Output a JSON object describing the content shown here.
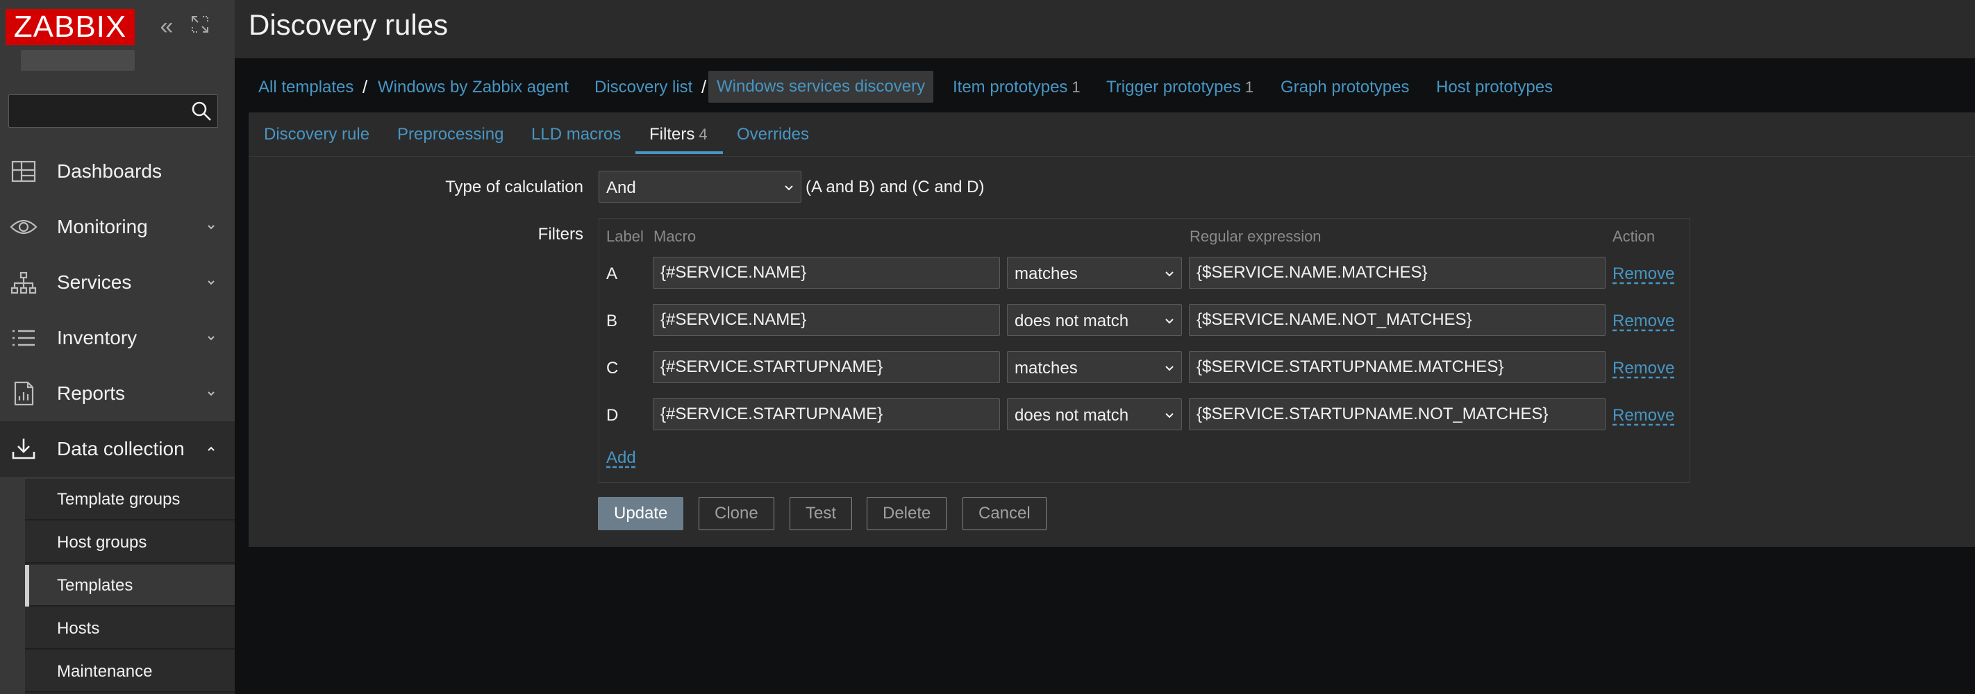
{
  "app": {
    "logo": "ZABBIX",
    "page_title": "Discovery rules"
  },
  "sidebar": {
    "search_placeholder": "",
    "search_value": "",
    "nav": [
      {
        "label": "Dashboards",
        "icon": "dashboards-icon",
        "expandable": false
      },
      {
        "label": "Monitoring",
        "icon": "eye-icon",
        "expandable": true
      },
      {
        "label": "Services",
        "icon": "services-icon",
        "expandable": true
      },
      {
        "label": "Inventory",
        "icon": "list-icon",
        "expandable": true
      },
      {
        "label": "Reports",
        "icon": "report-icon",
        "expandable": true
      },
      {
        "label": "Data collection",
        "icon": "download-icon",
        "expandable": true,
        "expanded": true
      }
    ],
    "submenu": [
      {
        "label": "Template groups"
      },
      {
        "label": "Host groups"
      },
      {
        "label": "Templates",
        "selected": true
      },
      {
        "label": "Hosts"
      },
      {
        "label": "Maintenance"
      }
    ]
  },
  "breadcrumbs": {
    "all_templates": "All templates",
    "template": "Windows by Zabbix agent",
    "discovery_list": "Discovery list",
    "current": "Windows services discovery",
    "item_prototypes": "Item prototypes",
    "item_prototypes_count": "1",
    "trigger_prototypes": "Trigger prototypes",
    "trigger_prototypes_count": "1",
    "graph_prototypes": "Graph prototypes",
    "host_prototypes": "Host prototypes",
    "separator": "/"
  },
  "tabs": {
    "discovery_rule": "Discovery rule",
    "preprocessing": "Preprocessing",
    "lld_macros": "LLD macros",
    "filters": "Filters",
    "filters_count": "4",
    "overrides": "Overrides"
  },
  "form": {
    "type_of_calculation_label": "Type of calculation",
    "type_of_calculation_value": "And",
    "calculation_expression": "(A and B) and (C and D)",
    "filters_label": "Filters",
    "columns": {
      "label": "Label",
      "macro": "Macro",
      "regex": "Regular expression",
      "action": "Action"
    },
    "rows": [
      {
        "label": "A",
        "macro": "{#SERVICE.NAME}",
        "operator": "matches",
        "regex": "{$SERVICE.NAME.MATCHES}",
        "action": "Remove"
      },
      {
        "label": "B",
        "macro": "{#SERVICE.NAME}",
        "operator": "does not match",
        "regex": "{$SERVICE.NAME.NOT_MATCHES}",
        "action": "Remove"
      },
      {
        "label": "C",
        "macro": "{#SERVICE.STARTUPNAME}",
        "operator": "matches",
        "regex": "{$SERVICE.STARTUPNAME.MATCHES}",
        "action": "Remove"
      },
      {
        "label": "D",
        "macro": "{#SERVICE.STARTUPNAME}",
        "operator": "does not match",
        "regex": "{$SERVICE.STARTUPNAME.NOT_MATCHES}",
        "action": "Remove"
      }
    ],
    "add_label": "Add"
  },
  "buttons": {
    "update": "Update",
    "clone": "Clone",
    "test": "Test",
    "delete": "Delete",
    "cancel": "Cancel"
  },
  "colors": {
    "brand_red": "#d40000",
    "link_blue": "#4796c4",
    "sidebar_bg": "#383838",
    "panel_bg": "#2b2b2b",
    "page_bg": "#0e1012"
  }
}
